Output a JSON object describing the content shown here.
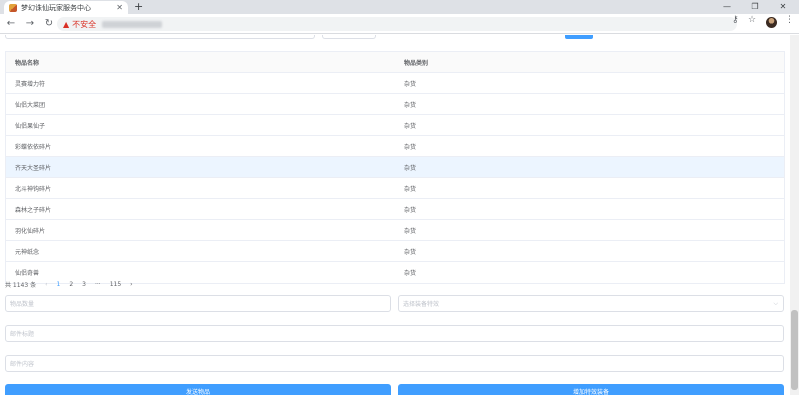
{
  "browser": {
    "tab_title": "梦幻诛仙玩家服务中心",
    "tab_close": "✕",
    "new_tab": "+",
    "insecure_label": "不安全",
    "minimize": "—",
    "restore": "❐",
    "close": "✕"
  },
  "table": {
    "headers": [
      "物品名称",
      "物品类别"
    ],
    "rows": [
      {
        "name": "灵赛增力符",
        "category": "杂货"
      },
      {
        "name": "仙侣大菜团",
        "category": "杂货"
      },
      {
        "name": "仙侣果仙子",
        "category": "杂货"
      },
      {
        "name": "彩蝶依依碎片",
        "category": "杂货"
      },
      {
        "name": "齐天大圣碎片",
        "category": "杂货"
      },
      {
        "name": "北斗神钩碎片",
        "category": "杂货"
      },
      {
        "name": "森林之子碎片",
        "category": "杂货"
      },
      {
        "name": "羽化仙碎片",
        "category": "杂货"
      },
      {
        "name": "元神纸念",
        "category": "杂货"
      },
      {
        "name": "仙侣奇兽",
        "category": "杂货"
      }
    ],
    "highlighted_row": 4
  },
  "pagination": {
    "total": "共 1143 条",
    "prev": "‹",
    "pages": [
      "1",
      "2",
      "3"
    ],
    "ellipsis": "···",
    "last": "115",
    "next": "›",
    "current": "1"
  },
  "form": {
    "item_qty_placeholder": "物品数量",
    "equip_effect_placeholder": "选择装备特效",
    "mail_title_placeholder": "邮件标题",
    "mail_content_placeholder": "邮件内容",
    "send_button": "发送物品",
    "add_effect_button": "增加特效装备"
  },
  "colors": {
    "accent": "#409eff",
    "highlight_row": "#ecf5ff",
    "insecure": "#d93025"
  }
}
